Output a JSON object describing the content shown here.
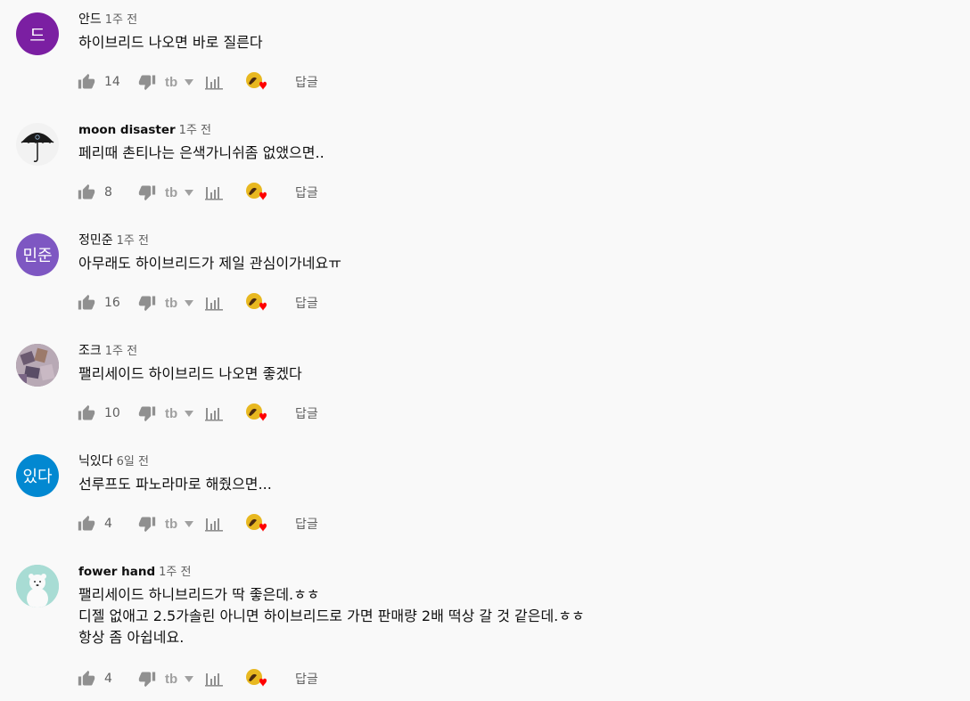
{
  "reply_label": "답글",
  "colors": {
    "heart": "#ff0000",
    "icon": "#909090",
    "subtext": "#606060"
  },
  "icons": [
    "thumb-up-icon",
    "thumb-down-icon",
    "tubebuddy-icon",
    "dropdown-arrow-icon",
    "analytics-icon",
    "creator-heart-icon"
  ],
  "comments": [
    {
      "author": "안드",
      "time": "1주 전",
      "avatar_text": "드",
      "avatar_color": "#7b1fa2",
      "lines": [
        "하이브리드 나오면 바로 질른다"
      ],
      "likes": "14"
    },
    {
      "author": "moon disaster",
      "time": "1주 전",
      "avatar_text": "",
      "avatar_color": "#ffffff",
      "lines": [
        "페리때 촌티나는 은색가니쉬좀 없앴으면.."
      ],
      "likes": "8"
    },
    {
      "author": "정민준",
      "time": "1주 전",
      "avatar_text": "민준",
      "avatar_color": "#7e57c2",
      "lines": [
        "아무래도 하이브리드가 제일 관심이가네요ㅠ"
      ],
      "likes": "16"
    },
    {
      "author": "조크",
      "time": "1주 전",
      "avatar_text": "",
      "avatar_color": "#8d7b8a",
      "lines": [
        "팰리세이드 하이브리드 나오면 좋겠다"
      ],
      "likes": "10"
    },
    {
      "author": "닉있다",
      "time": "6일 전",
      "avatar_text": "있다",
      "avatar_color": "#0288d1",
      "lines": [
        "선루프도 파노라마로 해줬으면..."
      ],
      "likes": "4"
    },
    {
      "author": "fower hand",
      "time": "1주 전",
      "avatar_text": "",
      "avatar_color": "#a8dcd4",
      "lines": [
        "팰리세이드 하니브리드가 딱 좋은데.ㅎㅎ",
        "디젤 없애고 2.5가솔린 아니면 하이브리드로 가면  판매량 2배 떡상 갈 것 같은데.ㅎㅎ",
        "항상 좀 아쉽네요."
      ],
      "likes": "4"
    }
  ]
}
